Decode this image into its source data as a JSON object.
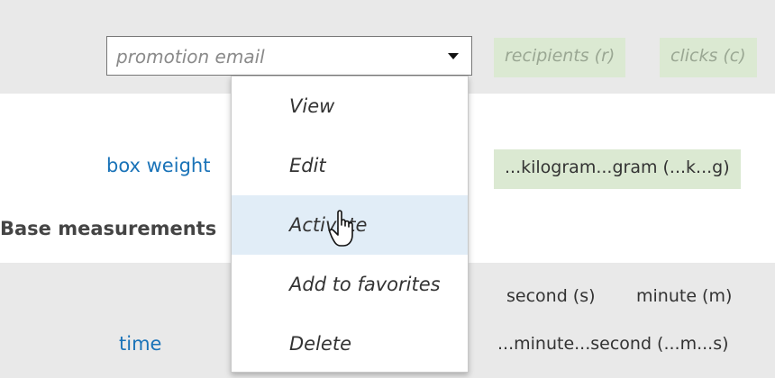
{
  "rows": {
    "row1": {
      "select_value": "promotion email",
      "chips": [
        "recipients (r)",
        "clicks (c)"
      ]
    },
    "row2": {
      "link": "box weight",
      "chip": "...kilogram...gram (...k...g)"
    },
    "section_title": "Base measurements",
    "row3": {
      "link": "time",
      "units": [
        "second (s)",
        "minute (m)"
      ],
      "equivalence": "...minute...second (...m...s)"
    }
  },
  "context_menu": {
    "items": [
      "View",
      "Edit",
      "Activate",
      "Add to favorites",
      "Delete"
    ],
    "hovered_index": 2
  },
  "colors": {
    "band": "#e9e9e9",
    "chip": "#dbe9d2",
    "link": "#1a73b8",
    "menu_hover": "#e1edf7"
  },
  "icons": {
    "dropdown": "chevron-down-icon",
    "cursor": "hand-pointer-icon"
  }
}
